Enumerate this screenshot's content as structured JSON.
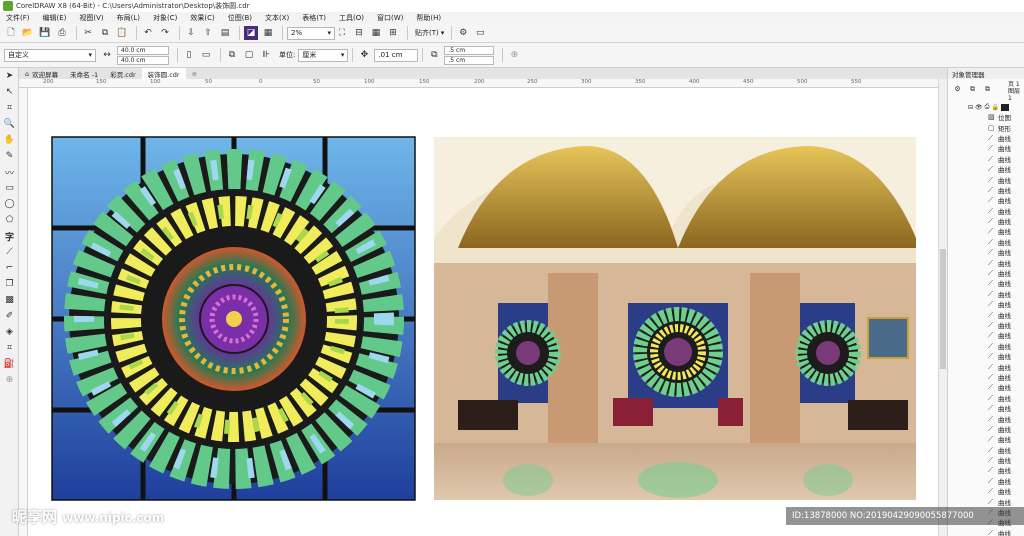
{
  "window": {
    "title": "CorelDRAW X8 (64-Bit) - C:\\Users\\Administrator\\Desktop\\装饰圆.cdr"
  },
  "menu": [
    "文件(F)",
    "编辑(E)",
    "视图(V)",
    "布局(L)",
    "对象(C)",
    "效果(C)",
    "位图(B)",
    "文本(X)",
    "表格(T)",
    "工具(O)",
    "窗口(W)",
    "帮助(H)"
  ],
  "toolbar": {
    "zoom": "2%",
    "snap": "贴齐(T)"
  },
  "propbar": {
    "page_preset": "自定义",
    "width": "40.0 cm",
    "height": "40.0 cm",
    "unit_label": "单位:",
    "unit": "厘米",
    "nudge": ".01 cm",
    "dup_x": ".5 cm",
    "dup_y": ".5 cm"
  },
  "tabs": [
    "欢迎屏幕",
    "未命名 -1",
    "彩页.cdr",
    "装饰圆.cdr"
  ],
  "ruler": [
    "200",
    "150",
    "100",
    "50",
    "0",
    "50",
    "100",
    "150",
    "200",
    "250",
    "300",
    "350",
    "400",
    "450",
    "500",
    "550"
  ],
  "docker": {
    "title": "对象管理器",
    "page": "页 1",
    "layer": "图层 1",
    "objects": [
      {
        "type": "bitmap",
        "label": "位图"
      },
      {
        "type": "rect",
        "label": "矩形"
      },
      {
        "type": "curve",
        "label": "曲线"
      },
      {
        "type": "curve",
        "label": "曲线"
      },
      {
        "type": "curve",
        "label": "曲线"
      },
      {
        "type": "curve",
        "label": "曲线"
      },
      {
        "type": "curve",
        "label": "曲线"
      },
      {
        "type": "curve",
        "label": "曲线"
      },
      {
        "type": "curve",
        "label": "曲线"
      },
      {
        "type": "curve",
        "label": "曲线"
      },
      {
        "type": "curve",
        "label": "曲线"
      },
      {
        "type": "curve",
        "label": "曲线"
      },
      {
        "type": "curve",
        "label": "曲线"
      },
      {
        "type": "curve",
        "label": "曲线"
      },
      {
        "type": "curve",
        "label": "曲线"
      },
      {
        "type": "curve",
        "label": "曲线"
      },
      {
        "type": "curve",
        "label": "曲线"
      },
      {
        "type": "curve",
        "label": "曲线"
      },
      {
        "type": "curve",
        "label": "曲线"
      },
      {
        "type": "curve",
        "label": "曲线"
      },
      {
        "type": "curve",
        "label": "曲线"
      },
      {
        "type": "curve",
        "label": "曲线"
      },
      {
        "type": "curve",
        "label": "曲线"
      },
      {
        "type": "curve",
        "label": "曲线"
      },
      {
        "type": "curve",
        "label": "曲线"
      },
      {
        "type": "curve",
        "label": "曲线"
      },
      {
        "type": "curve",
        "label": "曲线"
      },
      {
        "type": "curve",
        "label": "曲线"
      },
      {
        "type": "curve",
        "label": "曲线"
      },
      {
        "type": "curve",
        "label": "曲线"
      },
      {
        "type": "curve",
        "label": "曲线"
      },
      {
        "type": "curve",
        "label": "曲线"
      },
      {
        "type": "curve",
        "label": "曲线"
      },
      {
        "type": "curve",
        "label": "曲线"
      },
      {
        "type": "curve",
        "label": "曲线"
      },
      {
        "type": "curve",
        "label": "曲线"
      },
      {
        "type": "curve",
        "label": "曲线"
      },
      {
        "type": "curve",
        "label": "曲线"
      },
      {
        "type": "curve",
        "label": "曲线"
      },
      {
        "type": "curve",
        "label": "曲线"
      },
      {
        "type": "curve",
        "label": "曲线"
      }
    ]
  },
  "watermark": {
    "brand": "昵享网",
    "url": "www.nipic.com"
  },
  "image_id": "ID:13878000 NO:20190429090055877000",
  "colors": {
    "accent_green": "#5fa52e",
    "stained_blue": "#3a6fbf",
    "stained_yellow": "#f2ea57",
    "stained_green": "#4fae6e",
    "ceiling_gold": "#c9a033",
    "marble": "#b88f6a"
  }
}
